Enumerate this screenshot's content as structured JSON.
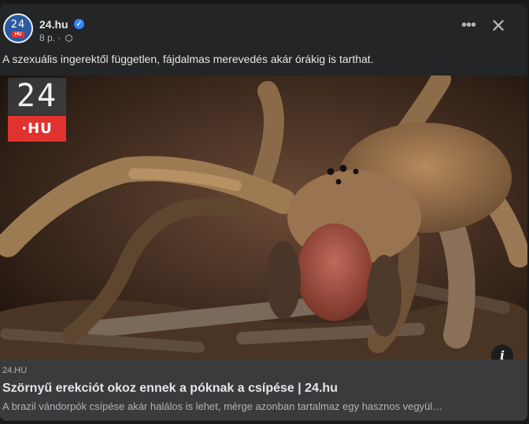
{
  "post": {
    "page_name": "24.hu",
    "avatar_logo_number": "24",
    "avatar_logo_tag": "HU",
    "time": "8 p.",
    "separator": "·",
    "text": "A szexuális ingerektől független, fájdalmas merevedés akár órákig is tarthat.",
    "more_icon_glyph": "•••",
    "close_icon_glyph": "✕",
    "verified_glyph": "✓"
  },
  "image": {
    "brand_number": "24",
    "brand_tag": "·HU",
    "description_icon": "spider-photo"
  },
  "link": {
    "domain": "24.HU",
    "title": "Szörnyű erekciót okoz ennek a póknak a csípése | 24.hu",
    "description": "A brazil vándorpók csípése akár halálos is lehet, mérge azonban tartalmaz egy hasznos vegyül…",
    "info_glyph": "i"
  },
  "colors": {
    "background": "#18191a",
    "card": "#242526",
    "link_box": "#3a3b3c",
    "accent_verified": "#2d88ff",
    "brand_red": "#e0332f"
  }
}
